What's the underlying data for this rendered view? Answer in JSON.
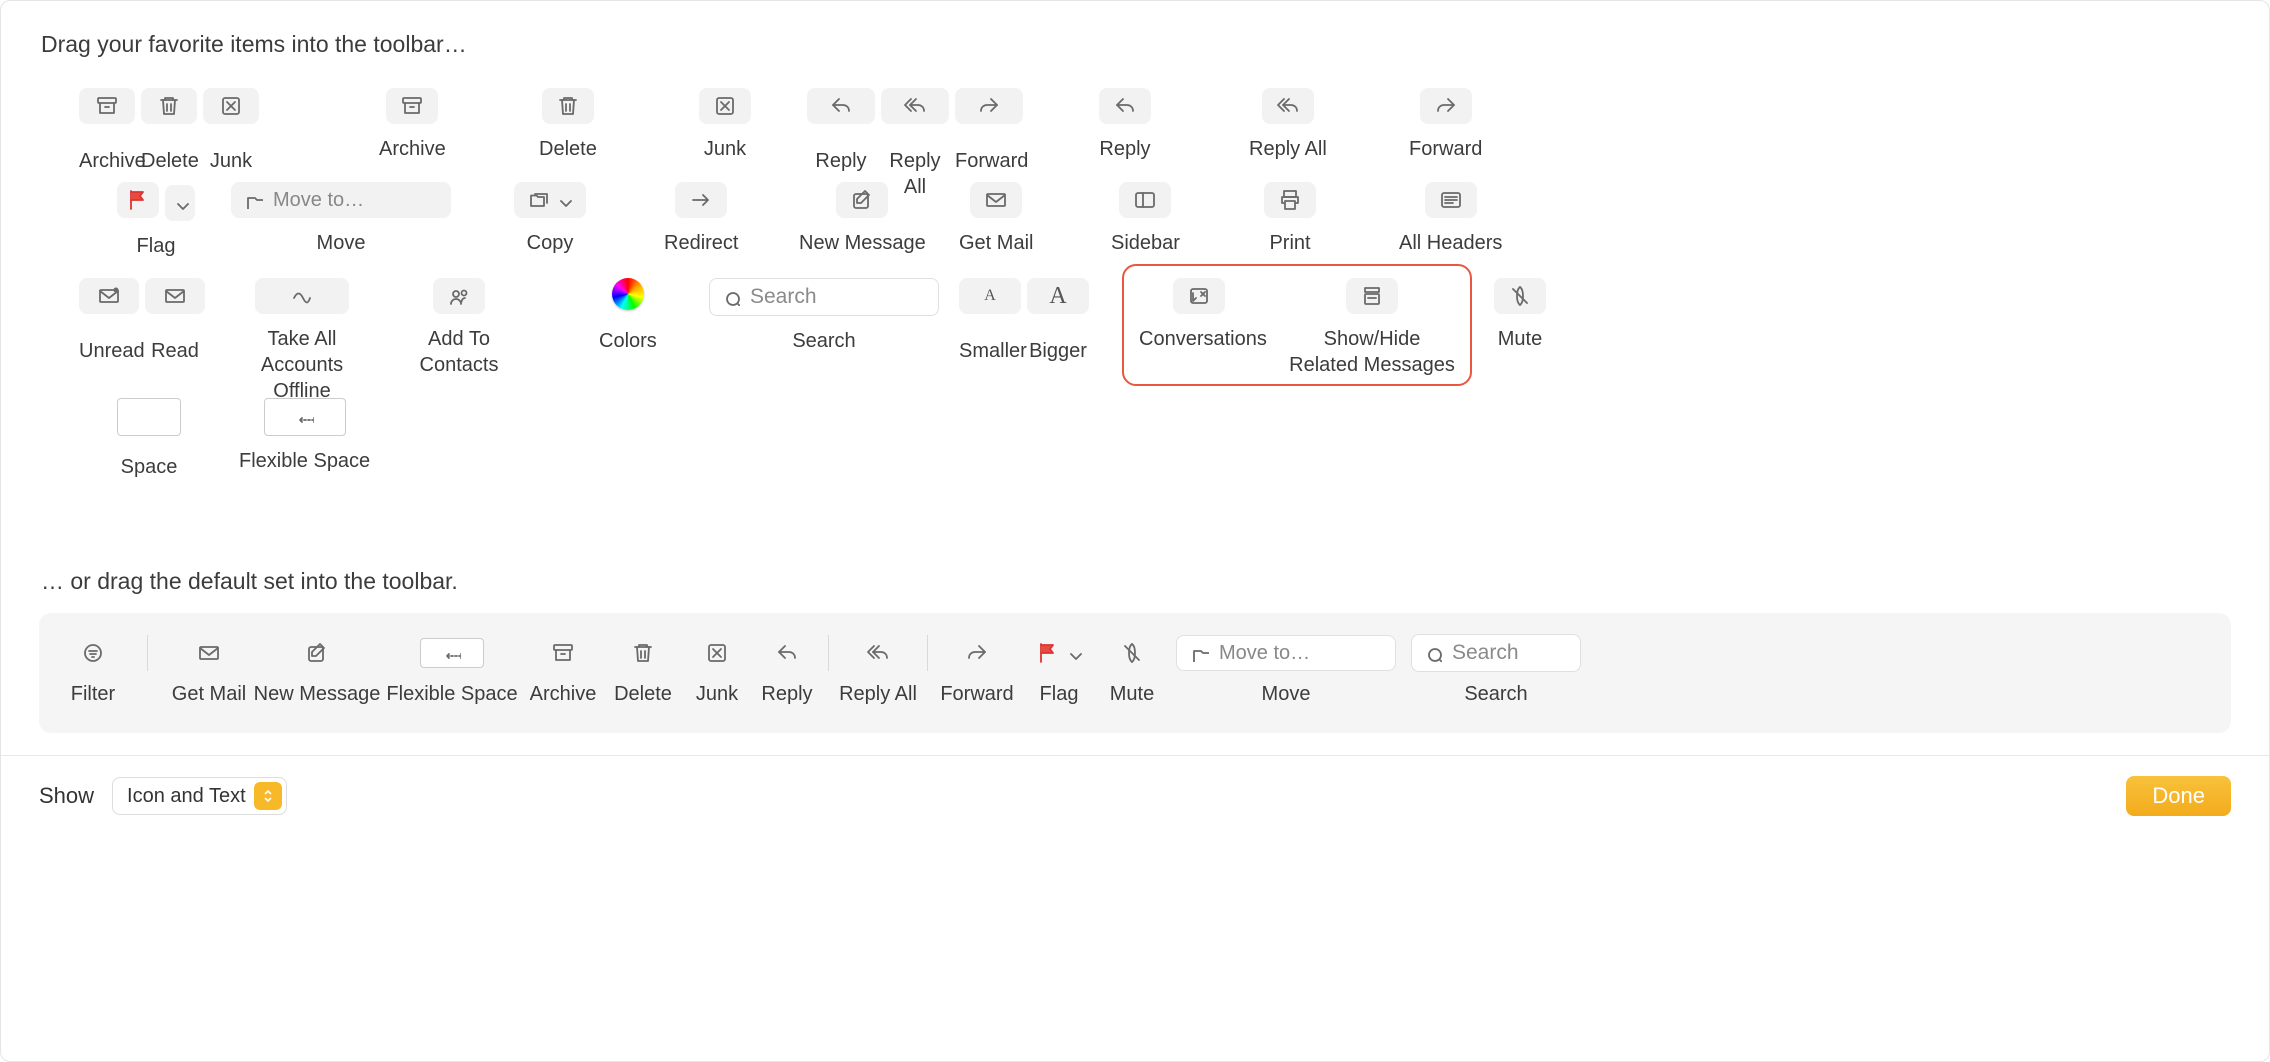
{
  "instruction_top": "Drag your favorite items into the toolbar…",
  "instruction_default": "… or drag the default set into the toolbar.",
  "items": {
    "archive": "Archive",
    "delete": "Delete",
    "junk": "Junk",
    "reply": "Reply",
    "reply_all": "Reply All",
    "forward": "Forward",
    "flag": "Flag",
    "move": "Move",
    "move_placeholder": "Move to…",
    "copy": "Copy",
    "redirect": "Redirect",
    "new_message": "New Message",
    "get_mail": "Get Mail",
    "sidebar": "Sidebar",
    "print": "Print",
    "all_headers": "All Headers",
    "unread": "Unread",
    "read": "Read",
    "take_offline": "Take All Accounts Offline",
    "add_contacts": "Add To Contacts",
    "colors": "Colors",
    "search": "Search",
    "search_placeholder": "Search",
    "smaller": "Smaller",
    "bigger": "Bigger",
    "conversations": "Conversations",
    "show_hide_related": "Show/Hide Related Messages",
    "mute": "Mute",
    "space": "Space",
    "flexible_space": "Flexible Space"
  },
  "default_bar": {
    "filter": "Filter",
    "get_mail": "Get Mail",
    "new_message": "New Message",
    "flexible_space": "Flexible Space",
    "archive": "Archive",
    "delete": "Delete",
    "junk": "Junk",
    "reply": "Reply",
    "reply_all": "Reply All",
    "forward": "Forward",
    "flag": "Flag",
    "mute": "Mute",
    "move": "Move",
    "move_placeholder": "Move to…",
    "search": "Search",
    "search_placeholder": "Search"
  },
  "footer": {
    "show_label": "Show",
    "select_value": "Icon and Text",
    "done": "Done"
  }
}
